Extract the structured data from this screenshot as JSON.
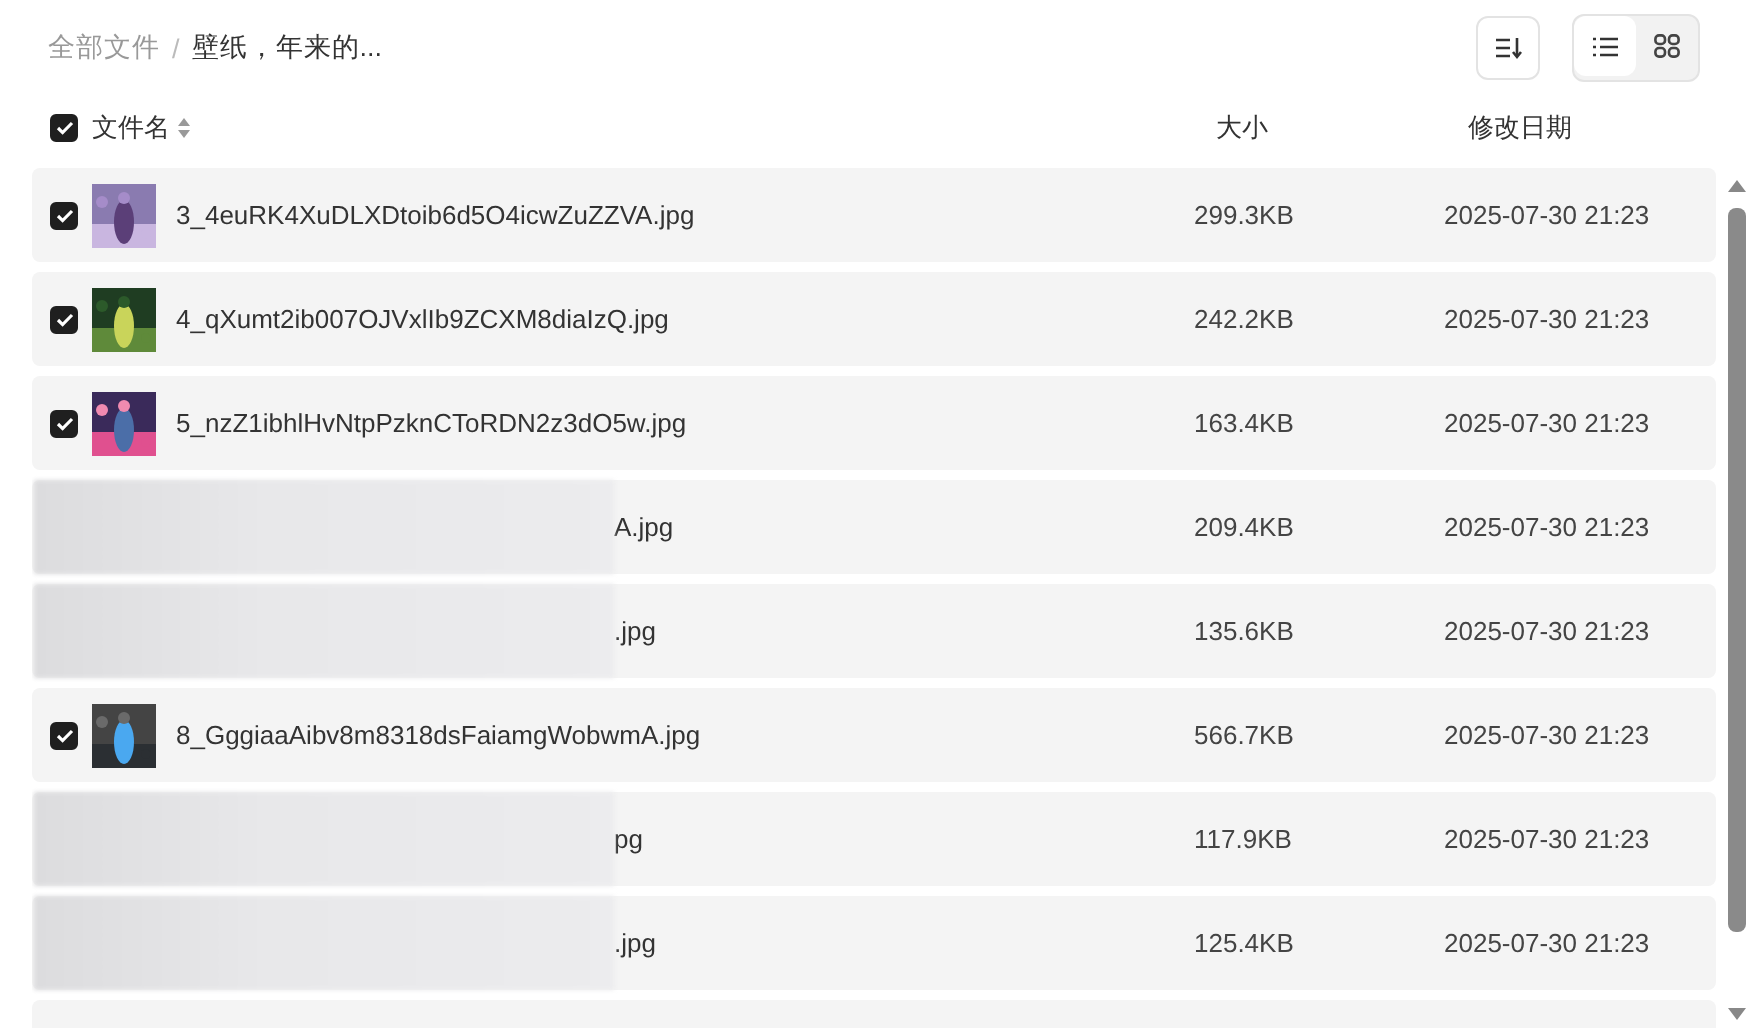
{
  "breadcrumb": [
    {
      "label": "全部文件",
      "current": false
    },
    {
      "label": "壁纸，年来的...",
      "current": true
    }
  ],
  "breadcrumb_separator": "/",
  "views": [
    {
      "kind": "list",
      "selected": true
    },
    {
      "kind": "grid",
      "selected": false
    }
  ],
  "table": {
    "select_all": true,
    "columns": [
      "文件名",
      "大小",
      "修改日期"
    ],
    "rows": [
      {
        "name": "3_4euRK4XuDLXDtoib6d5O4icwZuZZVA.jpg",
        "size": "299.3KB",
        "date": "2025-07-30 21:23",
        "checked": true,
        "redacted": false
      },
      {
        "name": "4_qXumt2ib007OJVxlIb9ZCXM8diaIzQ.jpg",
        "size": "242.2KB",
        "date": "2025-07-30 21:23",
        "checked": true,
        "redacted": false
      },
      {
        "name": "5_nzZ1ibhlHvNtpPzknCToRDN2z3dO5w.jpg",
        "size": "163.4KB",
        "date": "2025-07-30 21:23",
        "checked": true,
        "redacted": false
      },
      {
        "name": "A.jpg",
        "size": "209.4KB",
        "date": "2025-07-30 21:23",
        "redacted": true
      },
      {
        "name": ".jpg",
        "size": "135.6KB",
        "date": "2025-07-30 21:23",
        "redacted": true
      },
      {
        "name": "8_GggiaaAibv8m8318dsFaiamgWobwmA.jpg",
        "size": "566.7KB",
        "date": "2025-07-30 21:23",
        "checked": true,
        "redacted": false
      },
      {
        "name": "pg",
        "size": "117.9KB",
        "date": "2025-07-30 21:23",
        "redacted": true
      },
      {
        "name": ".jpg",
        "size": "125.4KB",
        "date": "2025-07-30 21:23",
        "redacted": true
      }
    ]
  }
}
